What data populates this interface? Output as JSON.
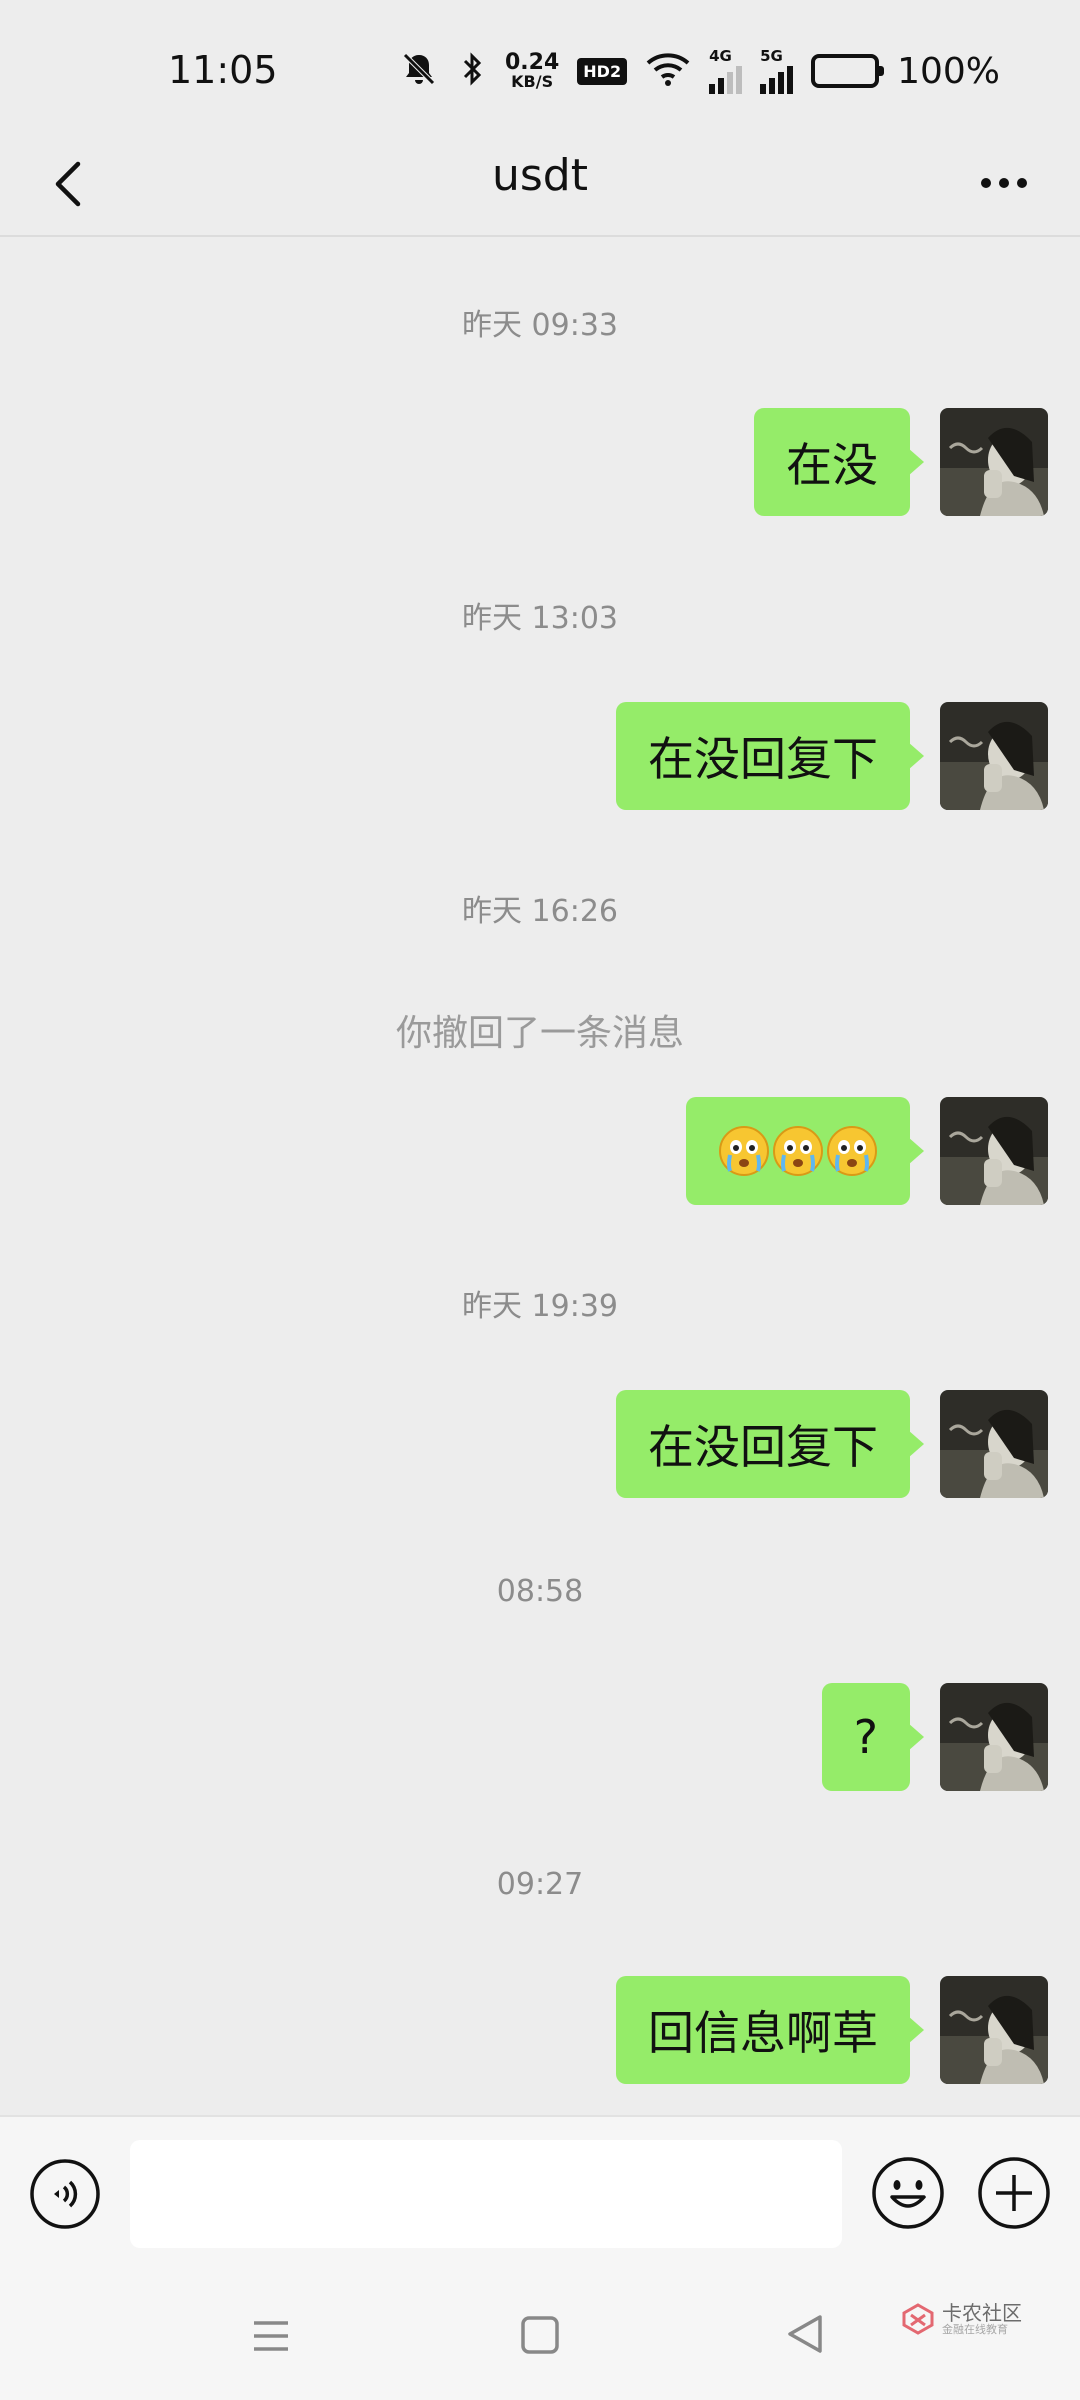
{
  "status_bar": {
    "time": "11:05",
    "net_speed_value": "0.24",
    "net_speed_unit": "KB/S",
    "hd_badge": "HD2",
    "sim1_label": "4G",
    "sim2_label": "5G",
    "battery_percent": "100%",
    "icons": [
      "mute-icon",
      "bluetooth-icon",
      "wifi-icon",
      "signal-icon",
      "battery-icon"
    ]
  },
  "header": {
    "title": "usdt",
    "back_icon": "chevron-left-icon",
    "more_icon": "more-dots-icon"
  },
  "messages": [
    {
      "type": "timestamp",
      "text": "昨天 09:33"
    },
    {
      "type": "sent",
      "text": "在没"
    },
    {
      "type": "timestamp",
      "text": "昨天 13:03"
    },
    {
      "type": "sent",
      "text": "在没回复下"
    },
    {
      "type": "timestamp",
      "text": "昨天 16:26"
    },
    {
      "type": "system",
      "text": "你撤回了一条消息"
    },
    {
      "type": "sent_emoji",
      "emoji": [
        "crying-face-emoji",
        "crying-face-emoji",
        "crying-face-emoji"
      ]
    },
    {
      "type": "timestamp",
      "text": "昨天 19:39"
    },
    {
      "type": "sent",
      "text": "在没回复下"
    },
    {
      "type": "timestamp",
      "text": "08:58"
    },
    {
      "type": "sent",
      "text": "?"
    },
    {
      "type": "timestamp",
      "text": "09:27"
    },
    {
      "type": "sent",
      "text": "回信息啊草"
    }
  ],
  "input_bar": {
    "voice_icon": "voice-icon",
    "input_value": "",
    "emoji_icon": "emoji-icon",
    "plus_icon": "plus-icon"
  },
  "nav_bar": {
    "icons": [
      "menu-icon",
      "home-icon",
      "back-triangle-icon"
    ],
    "watermark_main": "卡农社区",
    "watermark_sub": "金融在线教育"
  },
  "colors": {
    "background": "#ededed",
    "sent_bubble": "#95ec69",
    "timestamp_text": "#8c8c8c"
  }
}
